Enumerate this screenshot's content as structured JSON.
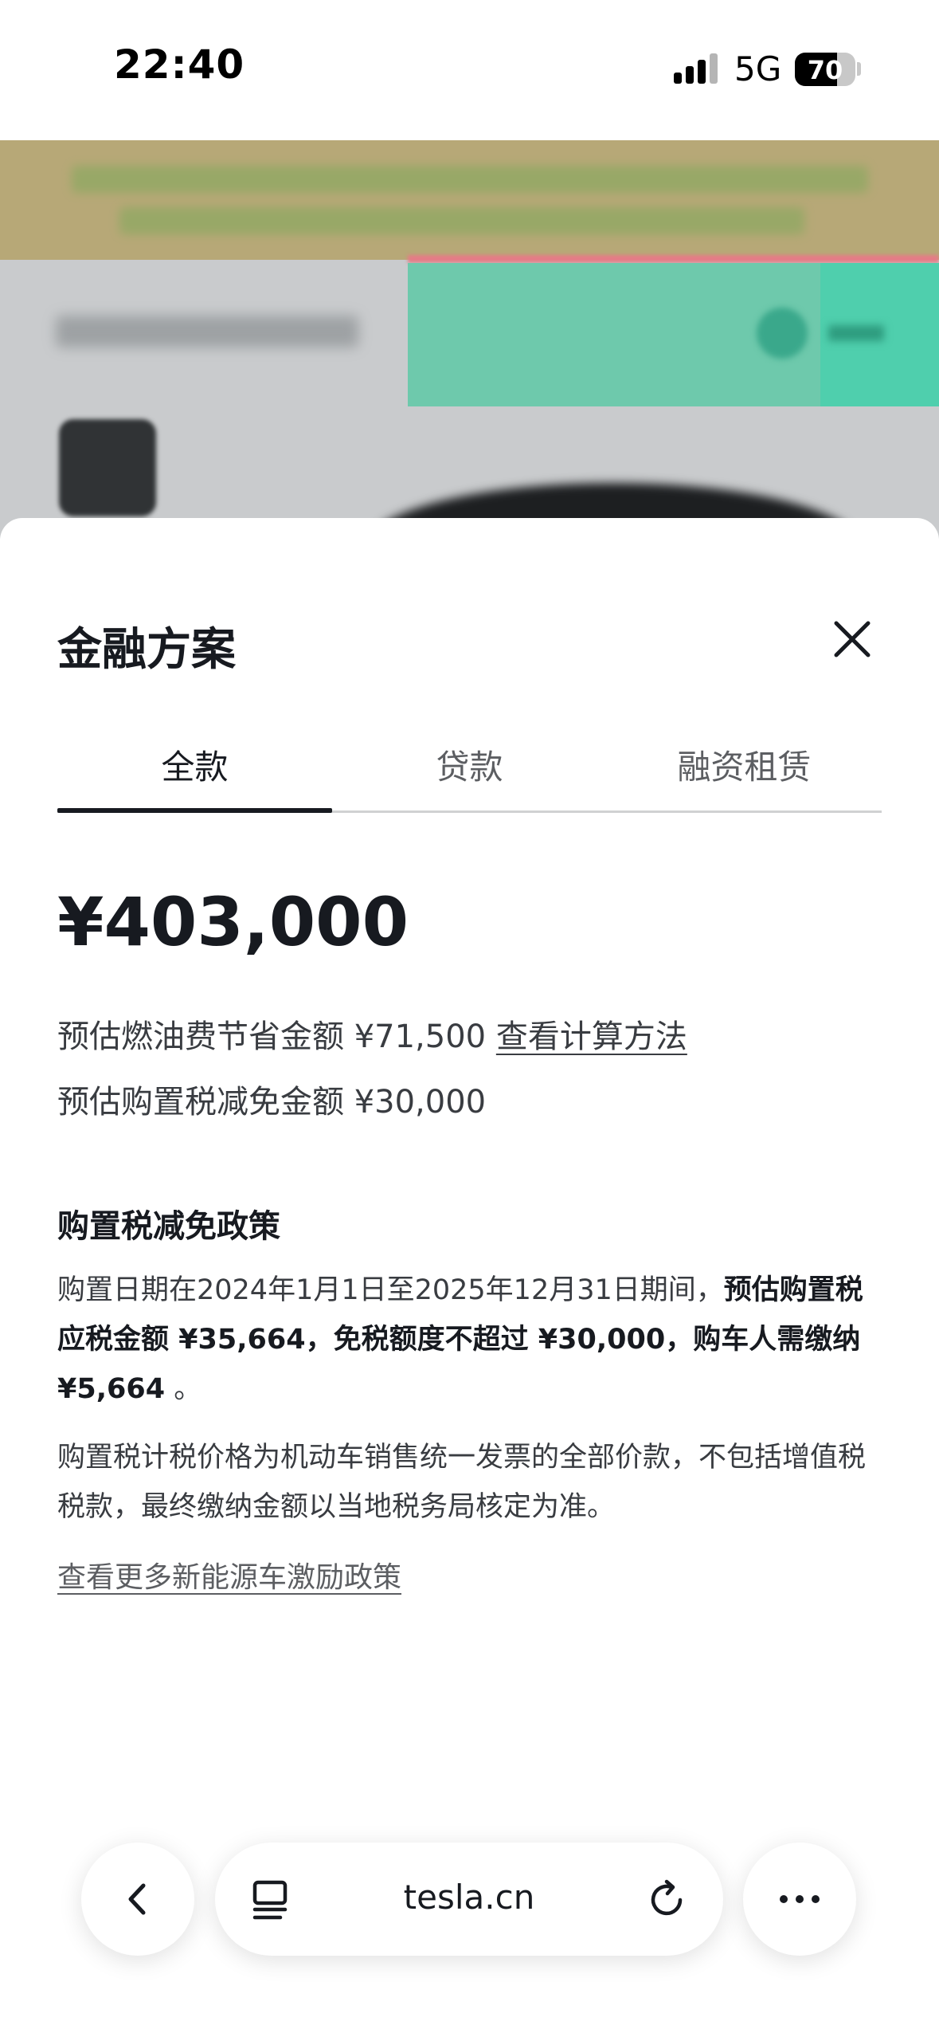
{
  "status_bar": {
    "time": "22:40",
    "network": "5G",
    "battery": "70",
    "battery_level": 0.7
  },
  "sheet": {
    "title": "金融方案",
    "tabs": [
      {
        "label": "全款",
        "active": true
      },
      {
        "label": "贷款",
        "active": false
      },
      {
        "label": "融资租赁",
        "active": false
      }
    ],
    "price": "¥403,000",
    "fuel_savings_text": "预估燃油费节省金额 ¥71,500",
    "fuel_savings_link": "查看计算方法",
    "tax_reduction_text": "预估购置税减免金额 ¥30,000",
    "policy_title": "购置税减免政策",
    "policy_para1_normal": "购置日期在2024年1月1日至2025年12月31日期间，",
    "policy_para1_bold": "预估购置税应税金额 ¥35,664，免税额度不超过 ¥30,000，购车人需缴纳 ¥5,664",
    "policy_para1_tail": " 。",
    "policy_para2": "购置税计税价格为机动车销售统一发票的全部价款，不包括增值税税款，最终缴纳金额以当地税务局核定为准。",
    "more_link": "查看更多新能源车激励政策"
  },
  "browser": {
    "url": "tesla.cn"
  },
  "icons": [
    "close-icon",
    "back-chevron-icon",
    "tabs-icon",
    "reload-icon",
    "more-dots-icon",
    "signal-icon",
    "battery-icon"
  ]
}
